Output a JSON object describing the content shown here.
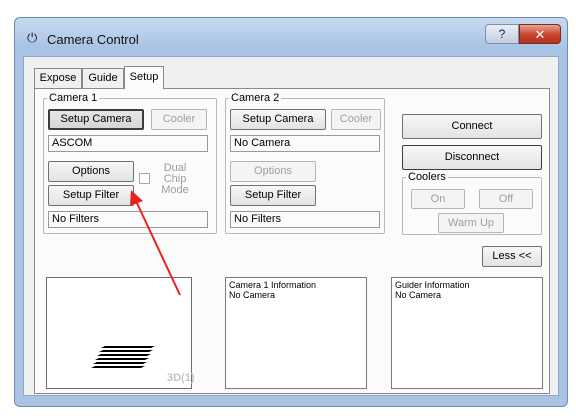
{
  "window": {
    "title": "Camera Control",
    "help_glyph": "?",
    "close_glyph": "✕",
    "icon": "camera-control-app-icon"
  },
  "tabs": [
    {
      "label": "Expose"
    },
    {
      "label": "Guide"
    },
    {
      "label": "Setup",
      "active": true
    }
  ],
  "camera1": {
    "group_label": "Camera 1",
    "setup_camera": "Setup Camera",
    "cooler": "Cooler",
    "camera_value": "ASCOM",
    "options": "Options",
    "dual_chip_mode": [
      "Dual",
      "Chip",
      "Mode"
    ],
    "setup_filter": "Setup Filter",
    "filter_value": "No Filters"
  },
  "camera2": {
    "group_label": "Camera 2",
    "setup_camera": "Setup Camera",
    "cooler": "Cooler",
    "camera_value": "No Camera",
    "options": "Options",
    "setup_filter": "Setup Filter",
    "filter_value": "No Filters"
  },
  "connection": {
    "connect": "Connect",
    "disconnect": "Disconnect"
  },
  "coolers": {
    "group_label": "Coolers",
    "on": "On",
    "off": "Off",
    "warm_up": "Warm Up"
  },
  "less_button": "Less <<",
  "preview": {
    "label": "3D(1)"
  },
  "camera1_info": {
    "title": "Camera 1 Information",
    "value": "No Camera"
  },
  "guider_info": {
    "title": "Guider Information",
    "value": "No Camera"
  },
  "annotation": {
    "color": "#e8231b",
    "points_to": "setup-filter-button-cam1"
  },
  "colors": {
    "window_frame": "#a9c3e4",
    "close_button": "#c7432c",
    "panel": "#fbfbfb"
  }
}
